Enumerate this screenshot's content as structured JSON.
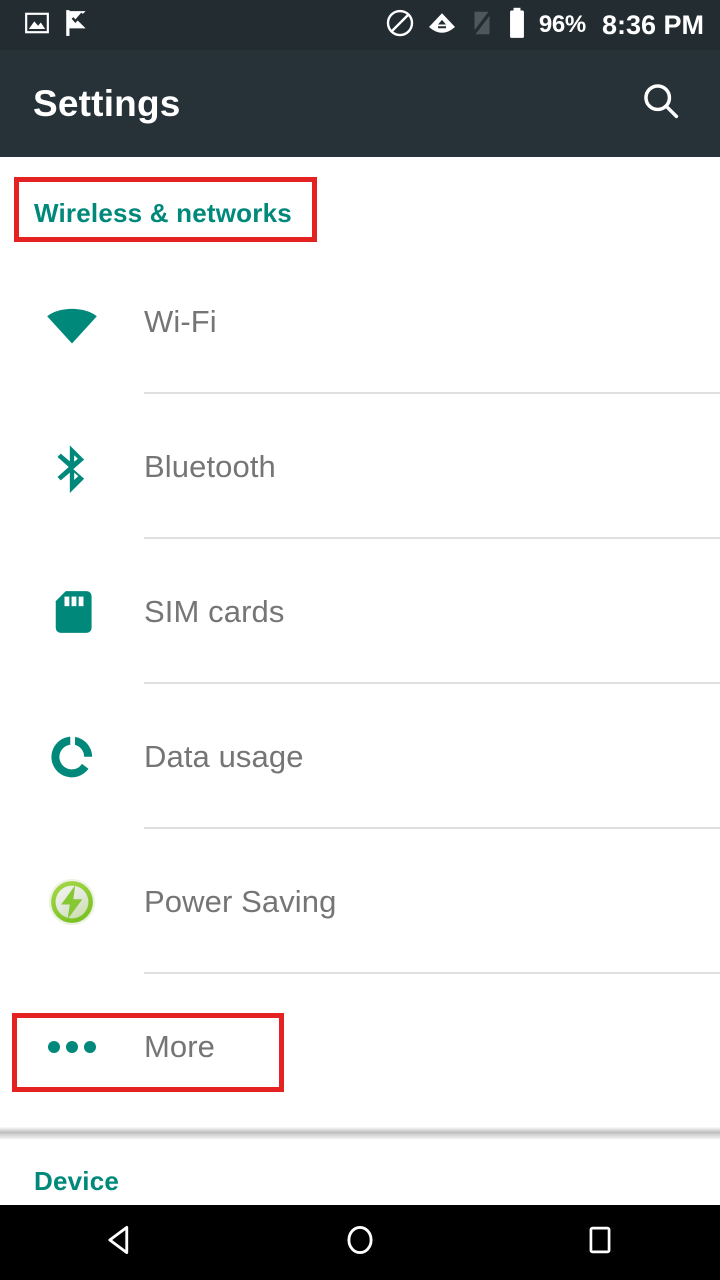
{
  "status_bar": {
    "battery_percent": "96%",
    "time": "8:36 PM",
    "icons": [
      "image-icon",
      "checkmark-flag-icon",
      "do-not-disturb-icon",
      "wifi-icon",
      "signal-off-icon",
      "battery-icon"
    ],
    "background_color": "#232c31"
  },
  "app_bar": {
    "title": "Settings",
    "search_icon": "search-icon",
    "background_color": "#263238"
  },
  "sections": [
    {
      "header": "Wireless & networks",
      "header_color": "#00897b",
      "items": [
        {
          "label": "Wi-Fi",
          "icon": "wifi-icon"
        },
        {
          "label": "Bluetooth",
          "icon": "bluetooth-icon"
        },
        {
          "label": "SIM cards",
          "icon": "sim-card-icon"
        },
        {
          "label": "Data usage",
          "icon": "data-usage-icon"
        },
        {
          "label": "Power Saving",
          "icon": "power-saving-icon"
        },
        {
          "label": "More",
          "icon": "more-dots-icon"
        }
      ]
    },
    {
      "header": "Device",
      "header_color": "#00897b",
      "items": []
    }
  ],
  "annotations": [
    {
      "target": "Wireless & networks",
      "color": "#e52222"
    },
    {
      "target": "More",
      "color": "#e52222"
    }
  ],
  "nav_bar": {
    "back": "back-icon",
    "home": "home-icon",
    "recents": "recents-icon",
    "background_color": "#000000"
  },
  "colors": {
    "accent_teal": "#00897b",
    "label_gray": "#757575",
    "annotation_red": "#e52222"
  }
}
